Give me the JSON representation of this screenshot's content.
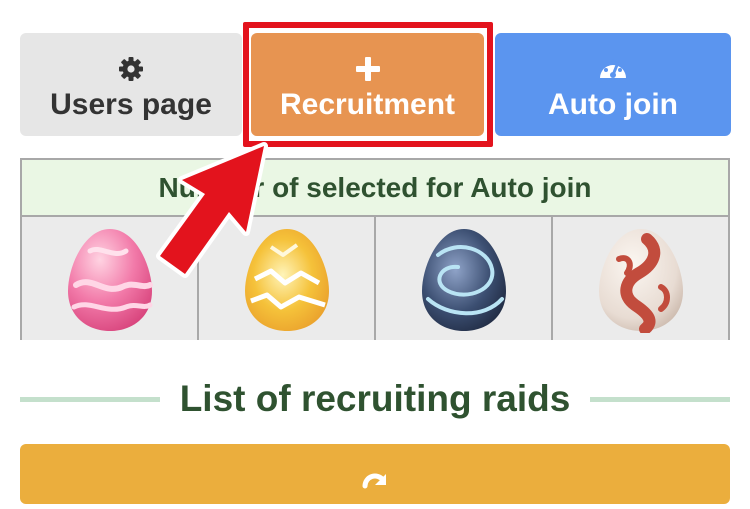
{
  "buttons": {
    "users": {
      "label": "Users page",
      "icon": "gear-icon",
      "color": "#e6e6e6"
    },
    "recruit": {
      "label": "Recruitment",
      "icon": "plus-icon",
      "color": "#e79451"
    },
    "auto_join": {
      "label": "Auto join",
      "icon": "speedometer-icon",
      "color": "#5b95ef"
    }
  },
  "egg_panel": {
    "header": "Number of selected for Auto join",
    "eggs": [
      {
        "name": "pink-egg",
        "colors": [
          "#f16aa0",
          "#ffc4d8"
        ]
      },
      {
        "name": "yellow-egg",
        "colors": [
          "#f0b52a",
          "#fff3c0"
        ]
      },
      {
        "name": "dark-egg",
        "colors": [
          "#2d3f5c",
          "#a9d9ee"
        ]
      },
      {
        "name": "red-egg",
        "colors": [
          "#c24c3d",
          "#efe6df"
        ]
      }
    ]
  },
  "section": {
    "title": "List of recruiting raids"
  },
  "refresh": {
    "icon": "refresh-icon",
    "color": "#ebae3d"
  },
  "annotation": {
    "highlight_color": "#e3131d"
  }
}
